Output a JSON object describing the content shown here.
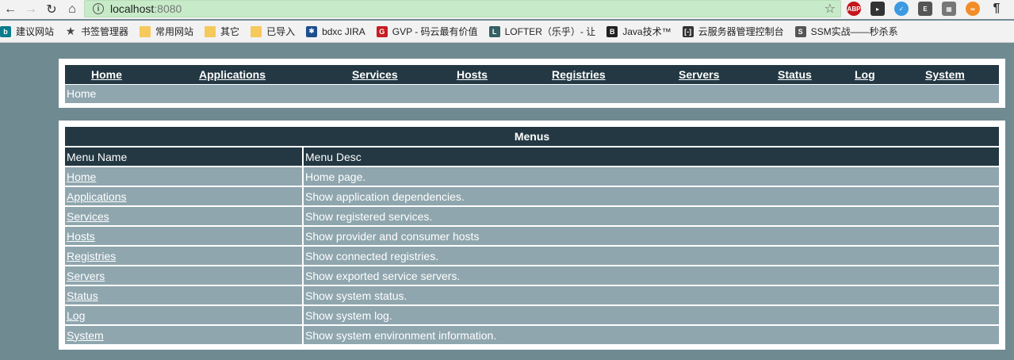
{
  "browser": {
    "url_host": "localhost",
    "url_port": ":8080",
    "bookmarks": [
      {
        "label": "建议网站",
        "icon": "bing-icon",
        "color": "#0a7c8c"
      },
      {
        "label": "书签管理器",
        "icon": "star-icon",
        "color": "#444444"
      },
      {
        "label": "常用网站",
        "icon": "folder-icon",
        "color": "#f5c95c"
      },
      {
        "label": "其它",
        "icon": "folder-icon",
        "color": "#f5c95c"
      },
      {
        "label": "已导入",
        "icon": "folder-icon",
        "color": "#f5c95c"
      },
      {
        "label": "bdxc JIRA",
        "icon": "jira-icon",
        "color": "#1d4f8c"
      },
      {
        "label": "GVP - 码云最有价值",
        "icon": "gitee-icon",
        "color": "#c71d23"
      },
      {
        "label": "LOFTER（乐乎）- 让",
        "icon": "lofter-icon",
        "color": "#345f64"
      },
      {
        "label": "Java技术™",
        "icon": "b-icon",
        "color": "#222222"
      },
      {
        "label": "云服务器管理控制台",
        "icon": "aliyun-icon",
        "color": "#333333"
      },
      {
        "label": "SSM实战——秒杀系",
        "icon": "s-icon",
        "color": "#555555"
      }
    ]
  },
  "nav": {
    "items": [
      "Home",
      "Applications",
      "Services",
      "Hosts",
      "Registries",
      "Servers",
      "Status",
      "Log",
      "System"
    ]
  },
  "breadcrumb": "Home",
  "menus": {
    "caption": "Menus",
    "col_name": "Menu Name",
    "col_desc": "Menu Desc",
    "rows": [
      {
        "name": "Home",
        "desc": "Home page."
      },
      {
        "name": "Applications",
        "desc": "Show application dependencies."
      },
      {
        "name": "Services",
        "desc": "Show registered services."
      },
      {
        "name": "Hosts",
        "desc": "Show provider and consumer hosts"
      },
      {
        "name": "Registries",
        "desc": "Show connected registries."
      },
      {
        "name": "Servers",
        "desc": "Show exported service servers."
      },
      {
        "name": "Status",
        "desc": "Show system status."
      },
      {
        "name": "Log",
        "desc": "Show system log."
      },
      {
        "name": "System",
        "desc": "Show system environment information."
      }
    ]
  },
  "colors": {
    "page_bg": "#708a92",
    "header_bg": "#233843",
    "row_bg": "#8fa6ae"
  }
}
